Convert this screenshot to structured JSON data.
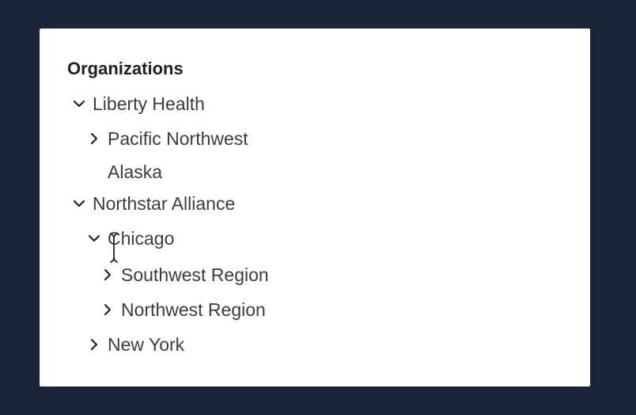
{
  "tree": {
    "title": "Organizations",
    "nodes": {
      "liberty_health": {
        "label": "Liberty Health",
        "state": "expanded"
      },
      "pacific_northwest": {
        "label": "Pacific Northwest",
        "state": "collapsed"
      },
      "alaska": {
        "label": "Alaska",
        "state": "leaf"
      },
      "northstar_alliance": {
        "label": "Northstar Alliance",
        "state": "expanded"
      },
      "chicago": {
        "label": "Chicago",
        "state": "expanded"
      },
      "southwest_region": {
        "label": "Southwest Region",
        "state": "collapsed"
      },
      "northwest_region": {
        "label": "Northwest Region",
        "state": "collapsed"
      },
      "new_york": {
        "label": "New York",
        "state": "collapsed"
      }
    }
  },
  "icons": {
    "expanded": "chevron-down-icon",
    "collapsed": "chevron-right-icon",
    "pointer": "text-cursor-icon"
  },
  "colors": {
    "background": "#1a2436",
    "panel": "#ffffff",
    "text": "#3c3c3c",
    "title": "#202124"
  }
}
